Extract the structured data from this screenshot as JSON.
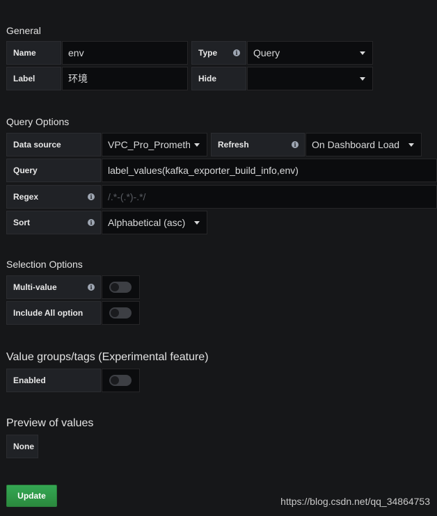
{
  "general": {
    "title": "General",
    "name_label": "Name",
    "name_value": "env",
    "type_label": "Type",
    "type_value": "Query",
    "label_label": "Label",
    "label_value": "环境",
    "hide_label": "Hide",
    "hide_value": ""
  },
  "query_options": {
    "title": "Query Options",
    "datasource_label": "Data source",
    "datasource_value": "VPC_Pro_Prometheus",
    "refresh_label": "Refresh",
    "refresh_value": "On Dashboard Load",
    "query_label": "Query",
    "query_value": "label_values(kafka_exporter_build_info,env)",
    "regex_label": "Regex",
    "regex_placeholder": "/.*-(.*)-.*/",
    "sort_label": "Sort",
    "sort_value": "Alphabetical (asc)"
  },
  "selection_options": {
    "title": "Selection Options",
    "multi_value_label": "Multi-value",
    "multi_value_on": false,
    "include_all_label": "Include All option",
    "include_all_on": false
  },
  "value_groups": {
    "title": "Value groups/tags (Experimental feature)",
    "enabled_label": "Enabled",
    "enabled_on": false
  },
  "preview": {
    "title": "Preview of values",
    "none_label": "None"
  },
  "actions": {
    "update_label": "Update"
  },
  "watermark": "https://blog.csdn.net/qq_34864753",
  "icons": {
    "info": "info-icon",
    "dropdown": "caret-down-icon"
  },
  "colors": {
    "background": "#161719",
    "label_bg": "#202226",
    "input_bg": "#0b0c0e",
    "update_button": "#2b8a3e"
  }
}
